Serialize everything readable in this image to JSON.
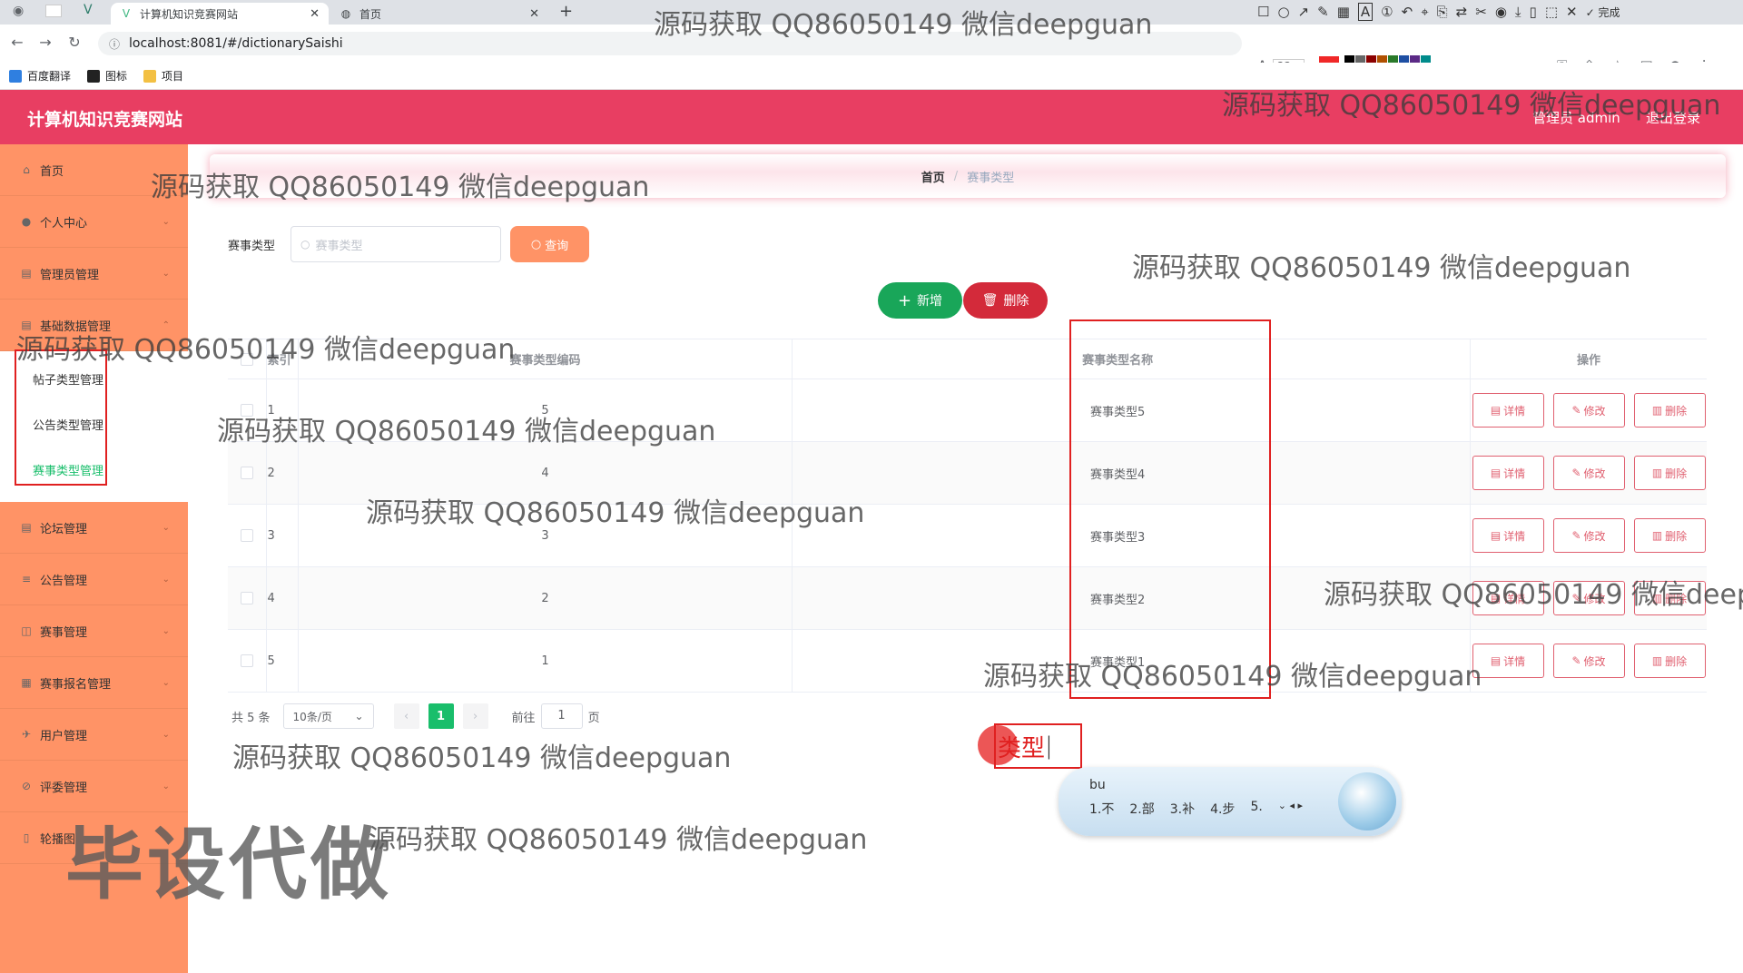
{
  "browser": {
    "tabs": [
      {
        "title": "计算机知识竞赛网站",
        "active": true
      },
      {
        "title": "首页",
        "active": false
      }
    ],
    "url": "localhost:8081/#/dictionarySaishi",
    "bookmarks": [
      "百度翻译",
      "图标",
      "项目"
    ],
    "annot_font_size": "22",
    "annot_done_label": "完成"
  },
  "header": {
    "title": "计算机知识竞赛网站",
    "admin_text": "管理员 admin",
    "logout": "退出登录"
  },
  "sidebar": {
    "items": [
      {
        "label": "首页",
        "icon": "home-icon"
      },
      {
        "label": "个人中心",
        "icon": "user-icon"
      },
      {
        "label": "管理员管理",
        "icon": "admin-icon"
      },
      {
        "label": "基础数据管理",
        "icon": "data-icon"
      },
      {
        "label": "论坛管理",
        "icon": "forum-icon"
      },
      {
        "label": "公告管理",
        "icon": "notice-icon"
      },
      {
        "label": "赛事管理",
        "icon": "event-icon"
      },
      {
        "label": "赛事报名管理",
        "icon": "signup-icon"
      },
      {
        "label": "用户管理",
        "icon": "users-icon"
      },
      {
        "label": "评委管理",
        "icon": "judge-icon"
      },
      {
        "label": "轮播图",
        "icon": "carousel-icon"
      }
    ],
    "submenu": [
      "帖子类型管理",
      "公告类型管理",
      "赛事类型管理"
    ]
  },
  "breadcrumb": {
    "home": "首页",
    "current": "赛事类型"
  },
  "search": {
    "label": "赛事类型",
    "placeholder": "赛事类型",
    "button": "查询"
  },
  "actions": {
    "add": "新增",
    "delete": "删除"
  },
  "table": {
    "headers": {
      "index": "索引",
      "code": "赛事类型编码",
      "name": "赛事类型名称",
      "ops": "操作"
    },
    "rows": [
      {
        "index": "1",
        "code": "5",
        "name": "赛事类型5"
      },
      {
        "index": "2",
        "code": "4",
        "name": "赛事类型4"
      },
      {
        "index": "3",
        "code": "3",
        "name": "赛事类型3"
      },
      {
        "index": "4",
        "code": "2",
        "name": "赛事类型2"
      },
      {
        "index": "5",
        "code": "1",
        "name": "赛事类型1"
      }
    ],
    "op_labels": {
      "detail": "详情",
      "edit": "修改",
      "delete": "删除"
    }
  },
  "pager": {
    "total": "共 5 条",
    "size": "10条/页",
    "current": "1",
    "goto_prefix": "前往",
    "goto_value": "1",
    "goto_suffix": "页"
  },
  "ime": {
    "composition": "类型",
    "input": "bu",
    "candidates": [
      "1.不",
      "2.部",
      "3.补",
      "4.步",
      "5."
    ]
  },
  "watermarks": {
    "text": "源码获取 QQ86050149 微信deepguan",
    "big": "毕设代做"
  },
  "colors": {
    "header": "#e83e62",
    "sidebar": "#ff9366",
    "accent_green": "#19be6b",
    "add_button": "#19a659",
    "delete_button": "#d32a3a",
    "op_border": "#e06070",
    "highlight_box": "#e02020"
  }
}
